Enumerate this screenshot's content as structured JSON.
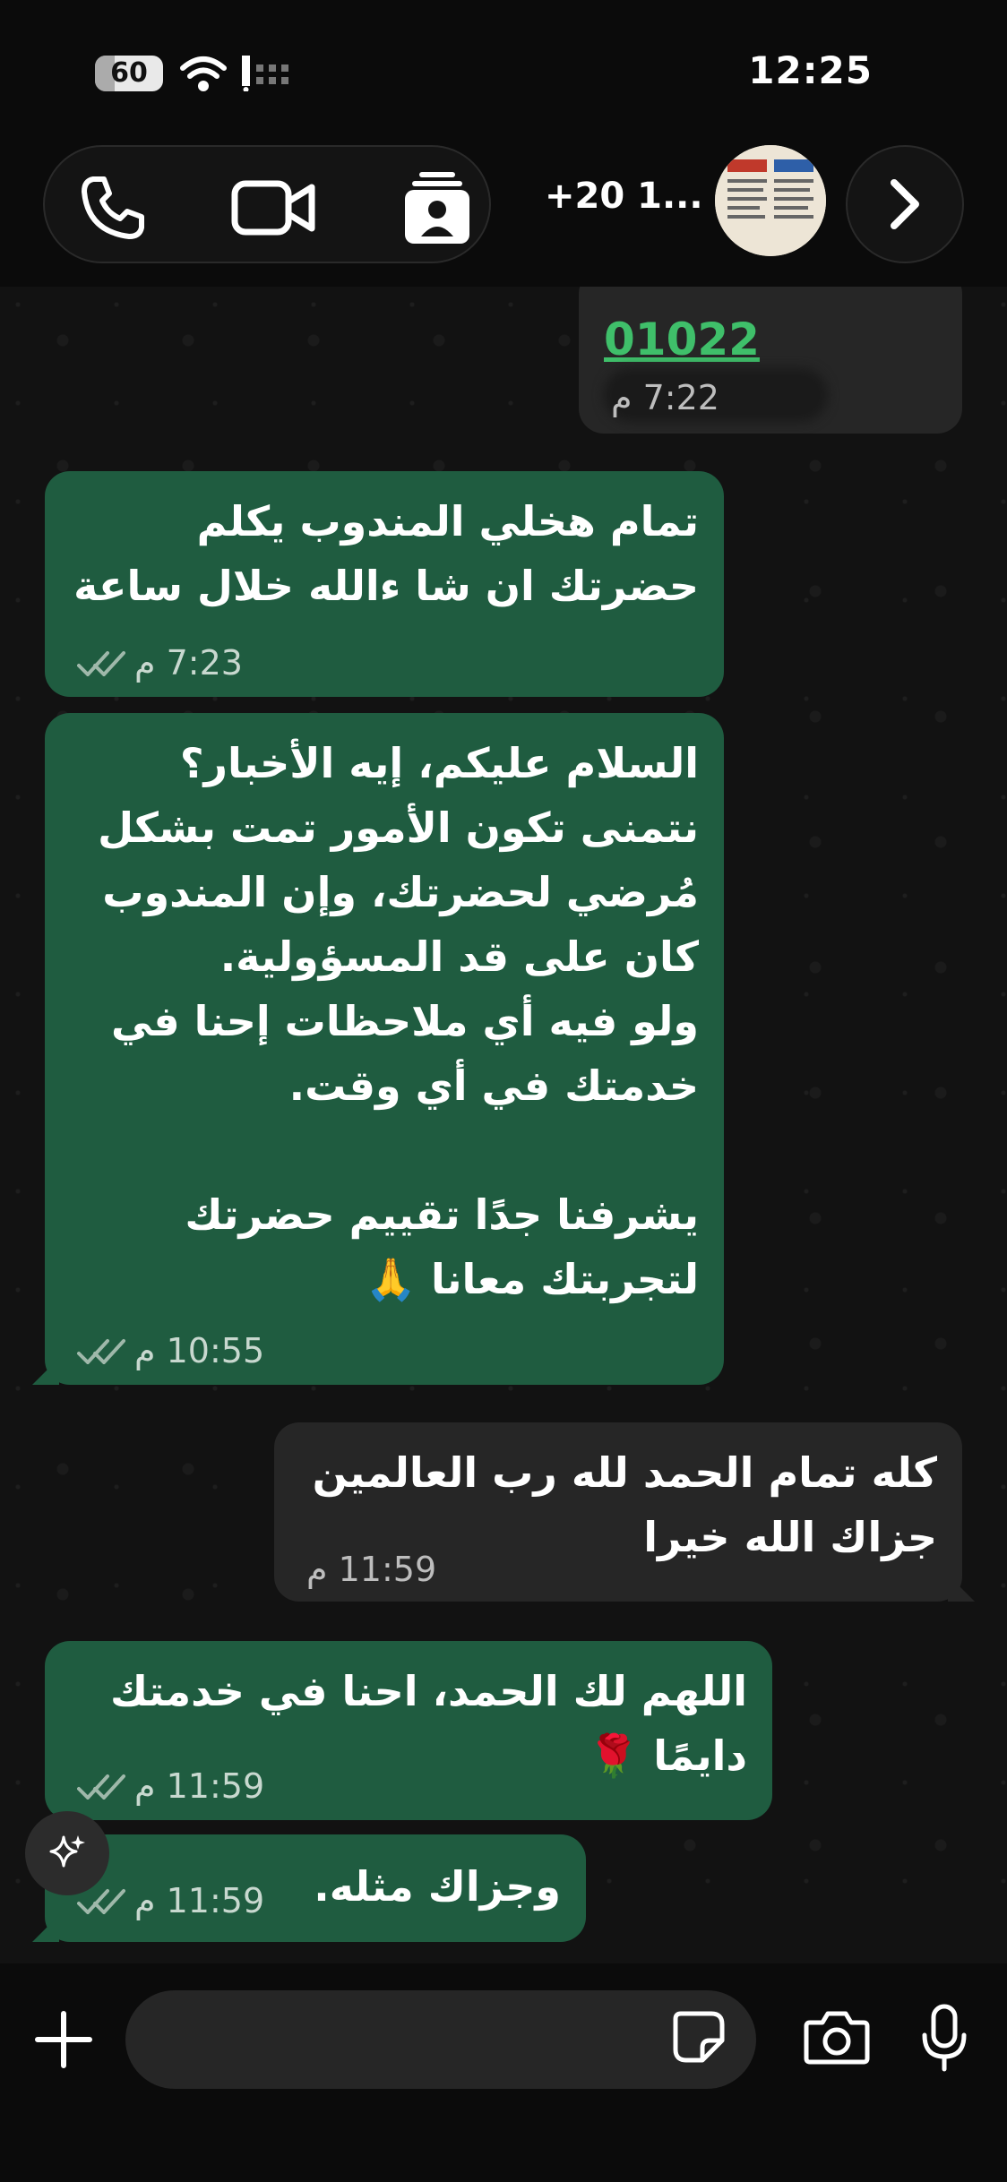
{
  "status_bar": {
    "battery": "60",
    "time": "12:25"
  },
  "header": {
    "contact_name": "+20 1..."
  },
  "messages": [
    {
      "id": "m1",
      "text": "01022",
      "time": "7:22 م",
      "direction": "incoming"
    },
    {
      "id": "m2",
      "text": "تمام هخلي المندوب يكلم\nحضرتك ان شا ءالله خلال ساعة",
      "time": "7:23 م",
      "direction": "outgoing"
    },
    {
      "id": "m3",
      "text": "السلام عليكم، إيه الأخبار؟\nنتمنى تكون الأمور تمت بشكل\nمُرضي لحضرتك، وإن المندوب\nكان على قد المسؤولية.\nولو فيه أي ملاحظات إحنا في\nخدمتك في أي وقت.\n\nيشرفنا جدًا تقييم حضرتك\nلتجربتك معانا 🙏",
      "time": "10:55 م",
      "direction": "outgoing"
    },
    {
      "id": "m4",
      "text": "كله تمام الحمد لله رب العالمين\nجزاك الله خيرا",
      "time": "11:59 م",
      "direction": "incoming"
    },
    {
      "id": "m5",
      "text": "اللهم لك الحمد، احنا في خدمتك\nدايمًا 🌹",
      "time": "11:59 م",
      "direction": "outgoing"
    },
    {
      "id": "m6",
      "text": "وجزاك مثله.",
      "time": "11:59 م",
      "direction": "outgoing"
    }
  ],
  "composer": {
    "placeholder": ""
  },
  "colors": {
    "outgoing_bubble": "#1f5c40",
    "incoming_bubble": "#262626",
    "link": "#3fbf6a"
  },
  "icons": [
    "phone-icon",
    "video-icon",
    "contact-card-icon",
    "chevron-right-icon",
    "sparkle-icon",
    "plus-icon",
    "sticker-icon",
    "camera-icon",
    "mic-icon"
  ]
}
